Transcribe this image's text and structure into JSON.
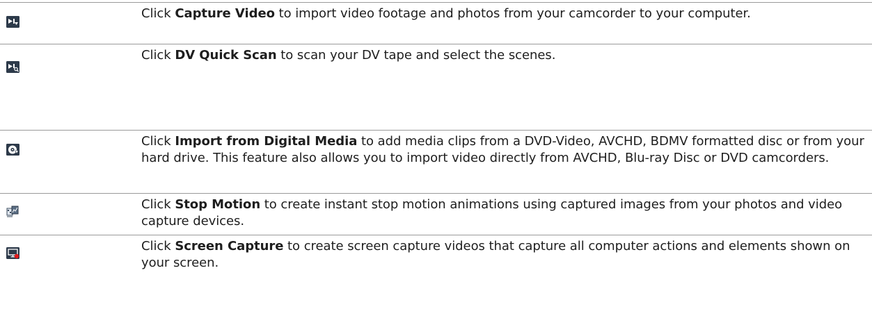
{
  "rows": [
    {
      "icon": "capture-video-icon",
      "prefix": "Click ",
      "bold": "Capture Video",
      "suffix": " to import video footage and photos from your camcorder to your computer."
    },
    {
      "icon": "dv-quick-scan-icon",
      "prefix": "Click ",
      "bold": "DV Quick Scan",
      "suffix": " to scan your DV tape and select the scenes."
    },
    {
      "icon": "import-digital-media-icon",
      "prefix": "Click ",
      "bold": "Import from Digital Media",
      "suffix": " to add media clips from a DVD-Video, AVCHD, BDMV formatted disc or from your hard drive. This feature also allows you to import video directly from AVCHD, Blu-ray Disc or DVD camcorders."
    },
    {
      "icon": "stop-motion-icon",
      "prefix": "Click ",
      "bold": "Stop Motion",
      "suffix": " to create instant stop motion animations using captured images from your photos and video capture devices."
    },
    {
      "icon": "screen-capture-icon",
      "prefix": "Click ",
      "bold": "Screen Capture",
      "suffix": " to create screen capture videos that capture all computer actions and elements shown on your screen."
    }
  ]
}
